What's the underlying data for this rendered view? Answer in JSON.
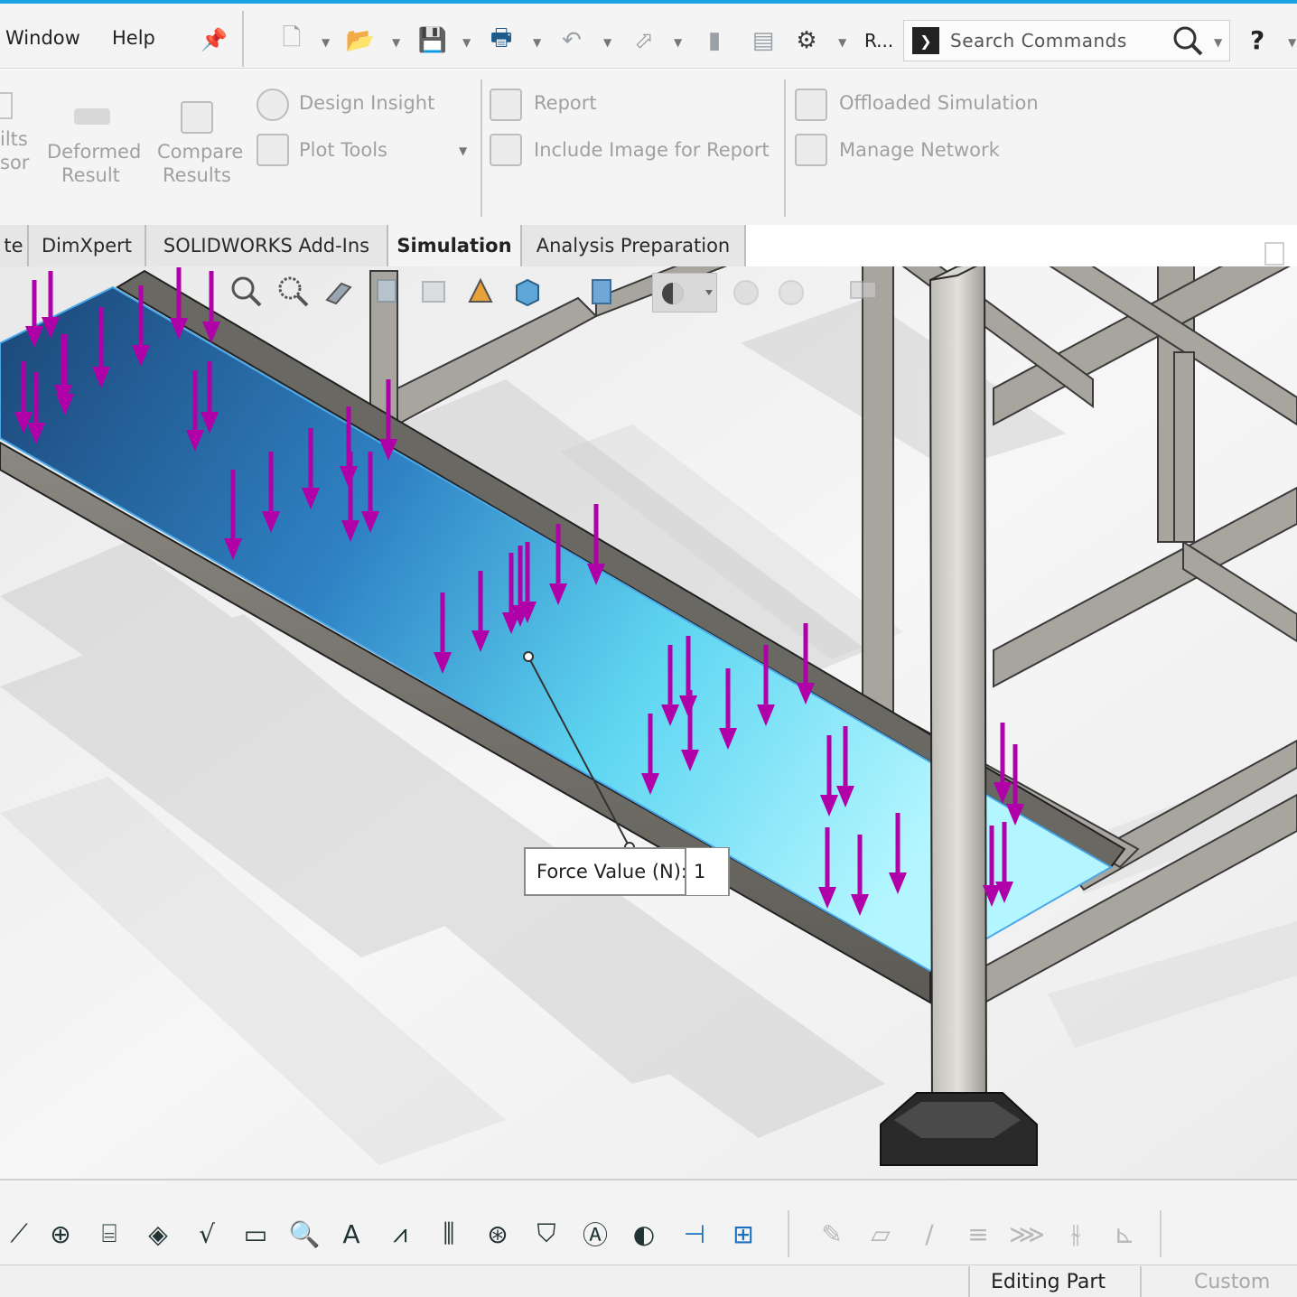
{
  "menu": {
    "window": "Window",
    "help": "Help"
  },
  "toolbar": {
    "rebuild_truncated": "R...",
    "search_placeholder": "Search Commands",
    "help_icon": "?"
  },
  "ribbon": {
    "results_advisor_partial_1": "ilts",
    "results_advisor_partial_2": "sor",
    "deformed_result_1": "Deformed",
    "deformed_result_2": "Result",
    "compare_results_1": "Compare",
    "compare_results_2": "Results",
    "design_insight": "Design Insight",
    "plot_tools": "Plot Tools",
    "report": "Report",
    "include_image": "Include Image for Report",
    "offloaded_simulation": "Offloaded Simulation",
    "manage_network": "Manage Network"
  },
  "tabs": [
    {
      "label": "te"
    },
    {
      "label": "DimXpert"
    },
    {
      "label": "SOLIDWORKS Add-Ins"
    },
    {
      "label": "Simulation"
    },
    {
      "label": "Analysis Preparation"
    }
  ],
  "force": {
    "label": "Force Value (N):",
    "value": "1"
  },
  "status": {
    "mode": "Editing Part",
    "units": "Custom"
  },
  "colors": {
    "accent": "#1ba1e2",
    "arrow": "#b000a8",
    "plate_start": "#1f4f86",
    "plate_end": "#a9f4ff"
  }
}
